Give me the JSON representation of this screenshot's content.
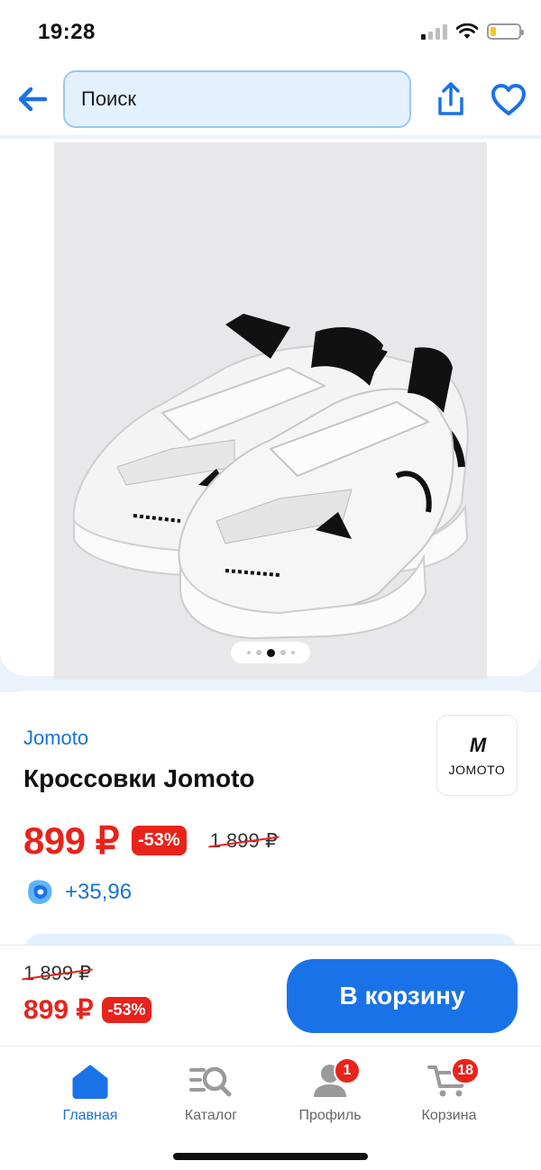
{
  "status_bar": {
    "time": "19:28"
  },
  "top_nav": {
    "search_placeholder": "Поиск"
  },
  "gallery": {
    "image_alt": "Кроссовки Jomoto",
    "dots_count": 5,
    "active_dot": 2
  },
  "product": {
    "brand": "Jomoto",
    "title": "Кроссовки Jomoto",
    "brand_logo_mark": "M",
    "brand_logo_text": "JOMOTO",
    "price": "899 ₽",
    "discount": "-53%",
    "old_price": "1 899 ₽",
    "bonus": "+35,96"
  },
  "buy_bar": {
    "old_price": "1 899 ₽",
    "price": "899 ₽",
    "discount": "-53%",
    "cart_button": "В корзину"
  },
  "tab_bar": {
    "tabs": [
      {
        "label": "Главная",
        "icon": "home-icon",
        "active": true
      },
      {
        "label": "Каталог",
        "icon": "catalog-search-icon",
        "active": false
      },
      {
        "label": "Профиль",
        "icon": "profile-icon",
        "active": false,
        "badge": "1"
      },
      {
        "label": "Корзина",
        "icon": "cart-icon",
        "active": false,
        "badge": "18"
      }
    ]
  },
  "colors": {
    "accent": "#1a72e8",
    "link": "#1a72d8",
    "sale": "#e8231c",
    "search_bg": "#e3f0fd"
  }
}
